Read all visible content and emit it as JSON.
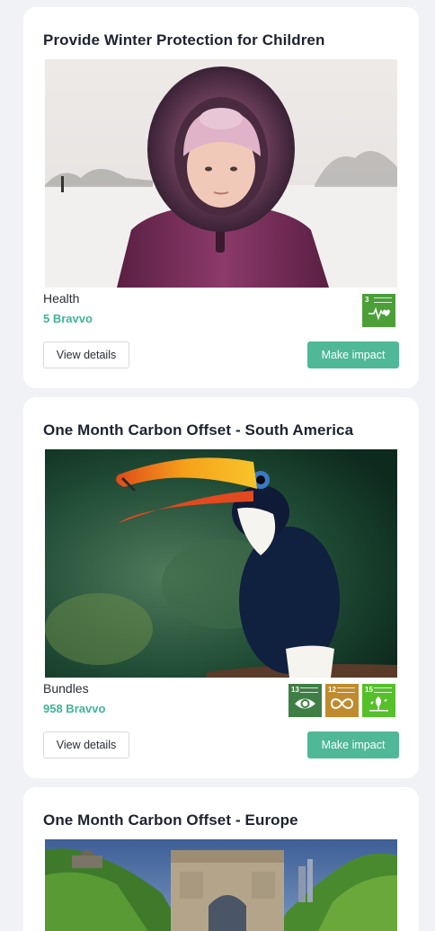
{
  "colors": {
    "page_bg": "#f1f2f5",
    "card_bg": "#ffffff",
    "accent": "#3fb496",
    "impact_button": "#4fb897",
    "sdg3": "#4c9f38",
    "sdg13": "#3f7e44",
    "sdg12": "#bf8b2e",
    "sdg15": "#56c02b"
  },
  "cards": [
    {
      "title": "Provide Winter Protection for Children",
      "image": "child-in-winter-coat-photo",
      "category": "Health",
      "bravvo": "5 Bravvo",
      "sdgs": [
        {
          "number": "3",
          "icon": "heartbeat-icon"
        }
      ],
      "view_details": "View details",
      "make_impact": "Make impact"
    },
    {
      "title": "One Month Carbon Offset - South America",
      "image": "toucan-photo",
      "category": "Bundles",
      "bravvo": "958 Bravvo",
      "sdgs": [
        {
          "number": "13",
          "icon": "eye-globe-icon"
        },
        {
          "number": "12",
          "icon": "infinity-icon"
        },
        {
          "number": "15",
          "icon": "tree-bird-icon"
        }
      ],
      "view_details": "View details",
      "make_impact": "Make impact"
    },
    {
      "title": "One Month Carbon Offset - Europe",
      "image": "arc-de-triomphe-photo"
    }
  ]
}
